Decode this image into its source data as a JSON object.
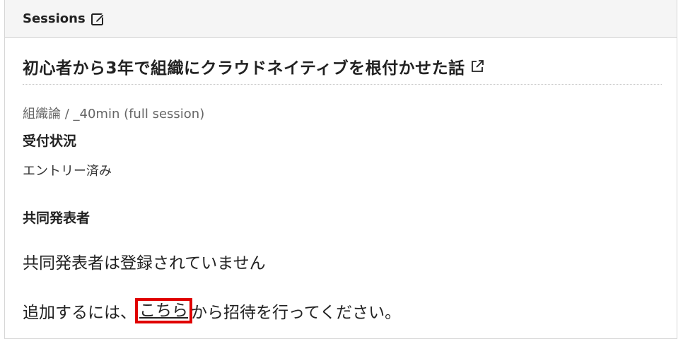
{
  "header": {
    "title": "Sessions",
    "edit_icon": "edit-square-pencil-icon"
  },
  "session": {
    "title": "初心者から3年で組織にクラウドネイティブを根付かせた話",
    "external_link_icon": "external-link-icon",
    "category": "組織論 / _40min (full session)"
  },
  "status": {
    "label": "受付状況",
    "value": "エントリー済み"
  },
  "co_presenters": {
    "label": "共同発表者",
    "empty_message": "共同発表者は登録されていません",
    "invite_prefix": "追加するには、",
    "invite_link": "こちら",
    "invite_suffix": "から招待を行ってください。",
    "highlight_color": "#e00000"
  }
}
